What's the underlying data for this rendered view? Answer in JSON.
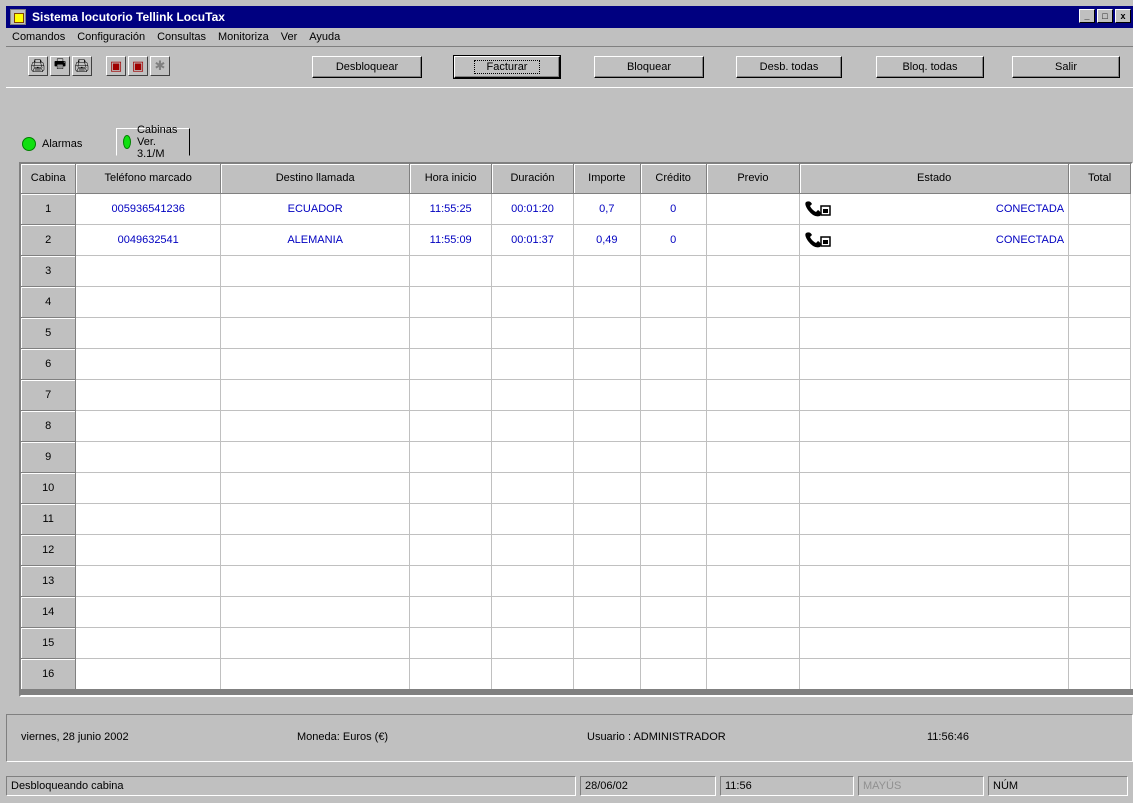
{
  "window": {
    "title": "Sistema locutorio Tellink LocuTax",
    "controls": [
      "_",
      "□",
      "x"
    ]
  },
  "menu": [
    "Comandos",
    "Configuración",
    "Consultas",
    "Monitoriza",
    "Ver",
    "Ayuda"
  ],
  "toolbar": {
    "buttons": [
      "Desbloquear",
      "Facturar",
      "Bloquear",
      "Desb. todas",
      "Bloq. todas",
      "Salir"
    ]
  },
  "tabs": [
    {
      "label": "Alarmas",
      "status_color": "#10e010"
    },
    {
      "label": "Cabinas Ver. 3.1/M",
      "status_color": "#10e010"
    }
  ],
  "grid": {
    "columns": [
      "Cabina",
      "Teléfono marcado",
      "Destino llamada",
      "Hora inicio",
      "Duración",
      "Importe",
      "Crédito",
      "Previo",
      "Estado",
      "Total"
    ],
    "rows": [
      {
        "cabina": "1",
        "telefono": "005936541236",
        "destino": "ECUADOR",
        "hora": "11:55:25",
        "duracion": "00:01:20",
        "importe": "0,7",
        "credito": "0",
        "previo": "",
        "estado": "CONECTADA",
        "estado_icon": "phone-handset-icon",
        "total": ""
      },
      {
        "cabina": "2",
        "telefono": "0049632541",
        "destino": "ALEMANIA",
        "hora": "11:55:09",
        "duracion": "00:01:37",
        "importe": "0,49",
        "credito": "0",
        "previo": "",
        "estado": "CONECTADA",
        "estado_icon": "phone-handset-icon",
        "total": ""
      },
      {
        "cabina": "3"
      },
      {
        "cabina": "4"
      },
      {
        "cabina": "5"
      },
      {
        "cabina": "6"
      },
      {
        "cabina": "7"
      },
      {
        "cabina": "8"
      },
      {
        "cabina": "9"
      },
      {
        "cabina": "10"
      },
      {
        "cabina": "11"
      },
      {
        "cabina": "12"
      },
      {
        "cabina": "13"
      },
      {
        "cabina": "14"
      },
      {
        "cabina": "15"
      },
      {
        "cabina": "16"
      }
    ]
  },
  "info": {
    "date": "viernes, 28 junio 2002",
    "currency": "Moneda: Euros (€)",
    "user": "Usuario : ADMINISTRADOR",
    "time": "11:56:46"
  },
  "status": {
    "message": "Desbloqueando cabina",
    "date": "28/06/02",
    "time": "11:56",
    "caps": "MAYÚS",
    "num": "NÚM"
  },
  "colors": {
    "titlebar": "#000080",
    "data_text": "#0000c0",
    "status_ok": "#10e010"
  }
}
